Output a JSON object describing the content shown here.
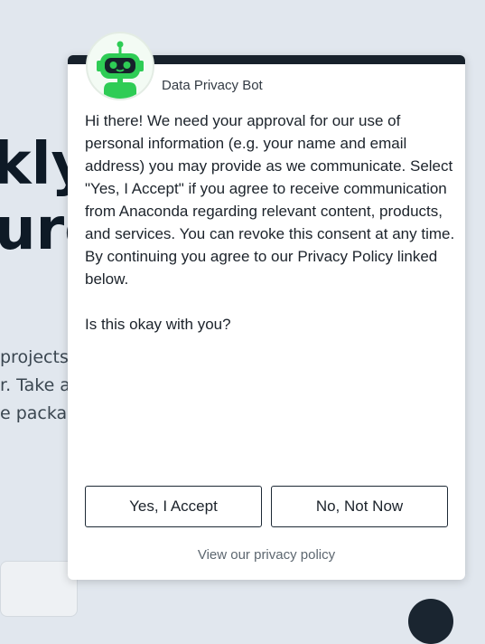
{
  "background": {
    "heading_line_1": "kly",
    "heading_line_2": "urc",
    "paragraph_lines": [
      "projects",
      "r. Take a",
      "e packa"
    ]
  },
  "chat": {
    "bot_name": "Data Privacy Bot",
    "avatar_icon": "robot-icon",
    "message_paragraphs": [
      "Hi there! We need your approval for our use of personal information (e.g. your name and email address) you may provide as we communicate. Select \"Yes, I Accept\" if you agree to receive communication from Anaconda regarding relevant content, products, and services. You can revoke this consent at any time. By continuing you agree to our Privacy Policy linked below.",
      "Is this okay with you?"
    ],
    "accept_label": "Yes, I Accept",
    "decline_label": "No, Not Now",
    "privacy_link": "View our privacy policy"
  },
  "colors": {
    "header_bar": "#17212b",
    "bot_green": "#2ecc55",
    "page_background": "#e1e7ee"
  }
}
